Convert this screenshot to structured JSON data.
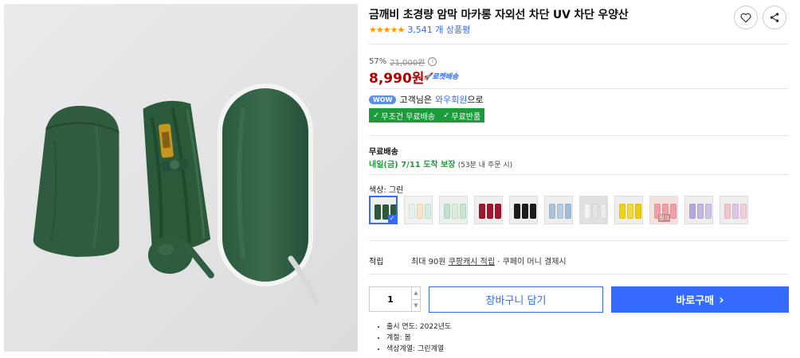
{
  "product": {
    "title": "금깨비 초경량 암막 마카롱 자외선 차단 UV 차단 우양산",
    "stars": "★★★★★",
    "review_count": "3,541 개 상품평"
  },
  "actions": {
    "wishlist_icon": "heart-icon",
    "share_icon": "share-icon"
  },
  "price": {
    "discount_rate": "57%",
    "original": "21,000원",
    "info_icon": "ⓘ",
    "sale": "8,990원",
    "rocket_label": "로켓배송"
  },
  "wow": {
    "badge": "WOW",
    "prefix": "고객님은",
    "link": "와우회원",
    "suffix": "으로"
  },
  "badges": {
    "free_shipping": "무조건 무료배송",
    "free_return": "무료반품"
  },
  "shipping": {
    "label": "무료배송",
    "date": "내일(금) 7/11 도착 보장",
    "note": "(53분 내 주문 시)"
  },
  "color": {
    "label": "색상:",
    "selected": "그린",
    "options": [
      {
        "name": "그린",
        "rolls": [
          "#2e5a3c",
          "#2e5a3c",
          "#2e5a3c"
        ],
        "bg": "#eef0ee"
      },
      {
        "name": "민트",
        "rolls": [
          "#e8f3ea",
          "#f2e8c8",
          "#d7efe0"
        ],
        "bg": "#f2f2f2"
      },
      {
        "name": "그린민트",
        "rolls": [
          "#bfe3c9",
          "#d8eedd",
          "#c6e7cf"
        ],
        "bg": "#eef0ee"
      },
      {
        "name": "와인",
        "rolls": [
          "#9c1830",
          "#9c1830",
          "#9c1830"
        ],
        "bg": "#eeeeee"
      },
      {
        "name": "블랙",
        "rolls": [
          "#1c1c1c",
          "#1c1c1c",
          "#1c1c1c"
        ],
        "bg": "#eeeeee"
      },
      {
        "name": "스카이블루",
        "rolls": [
          "#a9c3d9",
          "#b7cde0",
          "#a1bdd5"
        ],
        "bg": "#eeeeee"
      },
      {
        "name": "화이트",
        "rolls": [
          "#f4f4f4",
          "#e4e4e4",
          "#ededed"
        ],
        "bg": "#e0e0e0"
      },
      {
        "name": "옐로우",
        "rolls": [
          "#f0d11c",
          "#f3d93a",
          "#eccb10"
        ],
        "bg": "#eeeeee"
      },
      {
        "name": "핑크",
        "rolls": [
          "#f2a0a8",
          "#f2a0a8",
          "#f2a0a8"
        ],
        "bg": "#f6e1e1",
        "tag": "핑크"
      },
      {
        "name": "퍼플",
        "rolls": [
          "#b8a8d8",
          "#c4b7df",
          "#cfc2e6"
        ],
        "bg": "#eeeeee"
      },
      {
        "name": "핑크퍼플",
        "rolls": [
          "#f2c4cc",
          "#dcc6e4",
          "#f0d0d6"
        ],
        "bg": "#eeeeee"
      }
    ]
  },
  "points": {
    "label": "적립",
    "text": "최대 90원",
    "link": "쿠팡캐시 적립",
    "suffix": "· 쿠페이 머니 결제시"
  },
  "purchase": {
    "quantity": "1",
    "cart_label": "장바구니 담기",
    "buy_label": "바로구매",
    "buy_arrow": "›"
  },
  "details": [
    "출시 연도: 2022년도",
    "계절: 봄",
    "색상계열: 그린계열"
  ],
  "colors": {
    "accent": "#346aff",
    "price": "#ae0000",
    "green": "#1a9c3a",
    "star": "#ff9800"
  }
}
